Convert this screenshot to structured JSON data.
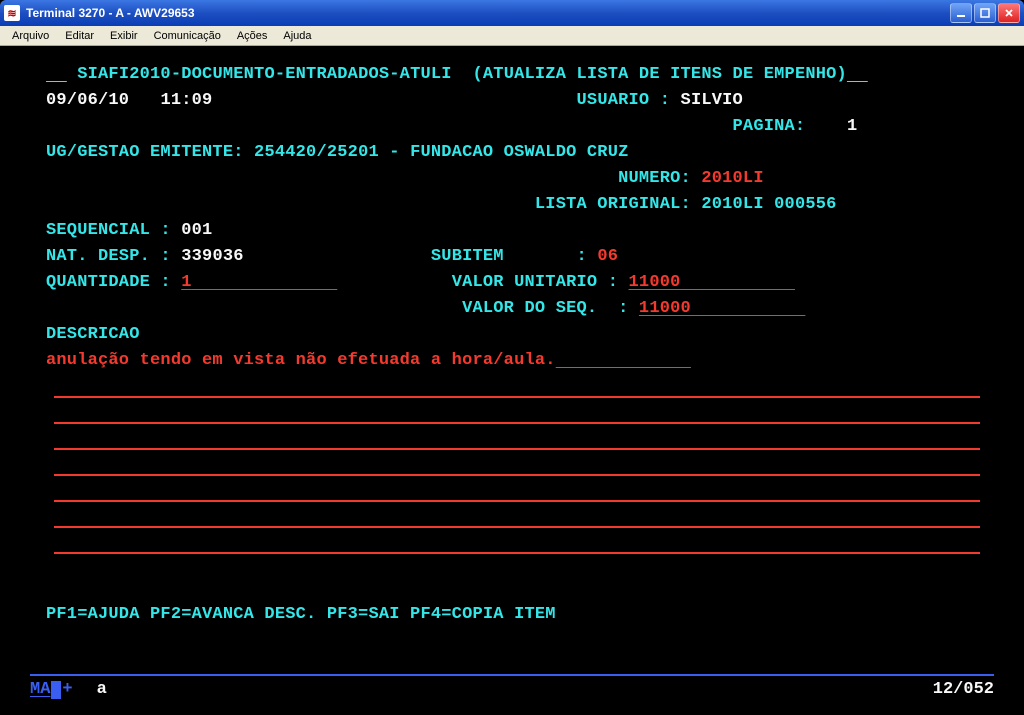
{
  "window": {
    "title": "Terminal 3270 - A - AWV29653"
  },
  "menubar": {
    "items": [
      "Arquivo",
      "Editar",
      "Exibir",
      "Comunicação",
      "Ações",
      "Ajuda"
    ]
  },
  "screen": {
    "header_path": "SIAFI2010-DOCUMENTO-ENTRADADOS-ATULI",
    "header_desc": "(ATUALIZA LISTA DE ITENS DE EMPENHO)",
    "date": "09/06/10",
    "time": "11:09",
    "usuario_label": "USUARIO :",
    "usuario_value": "SILVIO",
    "pagina_label": "PAGINA:",
    "pagina_value": "1",
    "ug_label": "UG/GESTAO EMITENTE:",
    "ug_value": "254420/25201 - FUNDACAO OSWALDO CRUZ",
    "numero_label": "NUMERO:",
    "numero_value": "2010LI",
    "lista_label": "LISTA ORIGINAL:",
    "lista_value": "2010LI 000556",
    "seq_label": "SEQUENCIAL :",
    "seq_value": "001",
    "nat_label": "NAT. DESP. :",
    "nat_value": "339036",
    "subitem_label": "SUBITEM       :",
    "subitem_value": "06",
    "quant_label": "QUANTIDADE :",
    "quant_value": "1",
    "valunit_label": "VALOR UNITARIO :",
    "valunit_value": "11000",
    "valseq_label": "VALOR DO SEQ.  :",
    "valseq_value": "11000",
    "desc_label": "DESCRICAO",
    "desc_text": "anulação tendo em vista não efetuada a hora/aula.",
    "pf_line": "PF1=AJUDA PF2=AVANCA DESC. PF3=SAI PF4=COPIA ITEM"
  },
  "status": {
    "ma": "MA",
    "plus": "+",
    "a": "a",
    "pos": "12/052"
  }
}
